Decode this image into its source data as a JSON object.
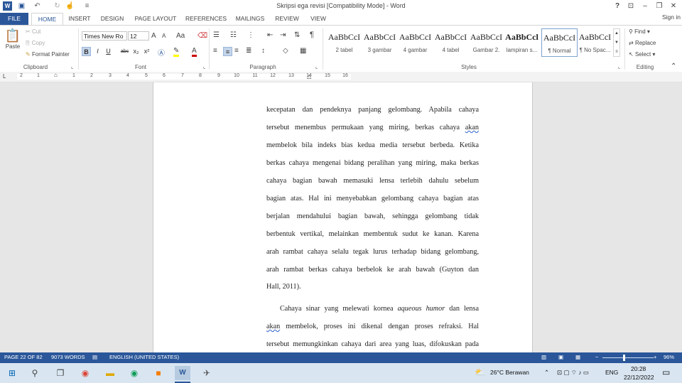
{
  "window": {
    "title": "Skripsi ega revisi [Compatibility Mode] - Word",
    "sign_in": "Sign in",
    "help": "?"
  },
  "tabs": [
    {
      "label": "FILE"
    },
    {
      "label": "HOME"
    },
    {
      "label": "INSERT"
    },
    {
      "label": "DESIGN"
    },
    {
      "label": "PAGE LAYOUT"
    },
    {
      "label": "REFERENCES"
    },
    {
      "label": "MAILINGS"
    },
    {
      "label": "REVIEW"
    },
    {
      "label": "VIEW"
    }
  ],
  "clipboard": {
    "group_label": "Clipboard",
    "paste": "Paste",
    "cut": "Cut",
    "copy": "Copy",
    "format_painter": "Format Painter"
  },
  "font": {
    "group_label": "Font",
    "font_name": "Times New Ro",
    "font_size": "12",
    "bold": "B",
    "italic": "I",
    "underline": "U",
    "strikethrough": "abc",
    "subscript": "x₂",
    "superscript": "x²",
    "grow": "A",
    "shrink": "A",
    "change_case": "Aa"
  },
  "paragraph": {
    "group_label": "Paragraph",
    "show_marks": "¶"
  },
  "styles": {
    "group_label": "Styles",
    "items": [
      {
        "sample": "AaBbCcI",
        "name": "2 tabel"
      },
      {
        "sample": "AaBbCcI",
        "name": "3 gambar"
      },
      {
        "sample": "AaBbCcI",
        "name": "4 gambar"
      },
      {
        "sample": "AaBbCcI",
        "name": "4 tabel"
      },
      {
        "sample": "AaBbCcI",
        "name": "Gambar 2."
      },
      {
        "sample": "AaBbCcl",
        "name": "lampiran s..."
      },
      {
        "sample": "AaBbCcI",
        "name": "¶ Normal"
      },
      {
        "sample": "AaBbCcI",
        "name": "¶ No Spac..."
      }
    ]
  },
  "editing": {
    "group_label": "Editing",
    "find": "Find",
    "replace": "Replace",
    "select": "Select"
  },
  "ruler": {
    "numbers": [
      "2",
      "1",
      "1",
      "2",
      "3",
      "4",
      "5",
      "6",
      "7",
      "8",
      "9",
      "10",
      "11",
      "12",
      "13",
      "14",
      "15",
      "16"
    ]
  },
  "document": {
    "lines": [
      {
        "parts": [
          {
            "t": "kecepatan dan pendeknya panjang gelombang. Apabila cahaya"
          }
        ]
      },
      {
        "parts": [
          {
            "t": "tersebut menembus permukaan yang miring, berkas cahaya "
          },
          {
            "t": "akan",
            "sq": true
          }
        ]
      },
      {
        "parts": [
          {
            "t": "membelok bila indeks bias kedua media tersebut berbeda. Ketika"
          }
        ]
      },
      {
        "parts": [
          {
            "t": "berkas cahaya mengenai bidang peralihan yang miring, maka berkas"
          }
        ]
      },
      {
        "parts": [
          {
            "t": "cahaya bagian bawah memasuki lensa terlebih dahulu sebelum"
          }
        ]
      },
      {
        "parts": [
          {
            "t": "bagian atas. Hal ini menyebabkan gelombang cahaya bagian atas"
          }
        ]
      },
      {
        "parts": [
          {
            "t": "berjalan mendahului bagian bawah, sehingga gelombang tidak"
          }
        ]
      },
      {
        "parts": [
          {
            "t": "berbentuk vertikal, melainkan membentuk sudut ke kanan. Karena"
          }
        ]
      },
      {
        "parts": [
          {
            "t": "arah rambat cahaya selalu tegak lurus terhadap bidang gelombang,"
          }
        ]
      },
      {
        "parts": [
          {
            "t": "arah rambat berkas cahaya berbelok ke arah bawah (Guyton dan"
          }
        ]
      },
      {
        "parts": [
          {
            "t": "Hall, 2011)."
          }
        ],
        "last": true
      },
      {
        "parts": [
          {
            "t": "Cahaya sinar yang melewati kornea "
          },
          {
            "t": "aqueous humor",
            "it": true
          },
          {
            "t": " dan lensa"
          }
        ],
        "indent": true
      },
      {
        "parts": [
          {
            "t": "akan",
            "sq": true
          },
          {
            "t": " membelok, proses ini dikenal dengan proses refraksi. Hal"
          }
        ]
      },
      {
        "parts": [
          {
            "t": "tersebut memungkinkan cahaya dari area yang luas, difokuskan pada"
          }
        ]
      }
    ]
  },
  "status": {
    "page": "PAGE 22 OF 82",
    "words": "9073 WORDS",
    "language": "ENGLISH (UNITED STATES)",
    "zoom": "96%"
  },
  "taskbar": {
    "weather": "26°C  Berawan",
    "lang": "ENG",
    "time": "20:28",
    "date": "22/12/2022"
  }
}
